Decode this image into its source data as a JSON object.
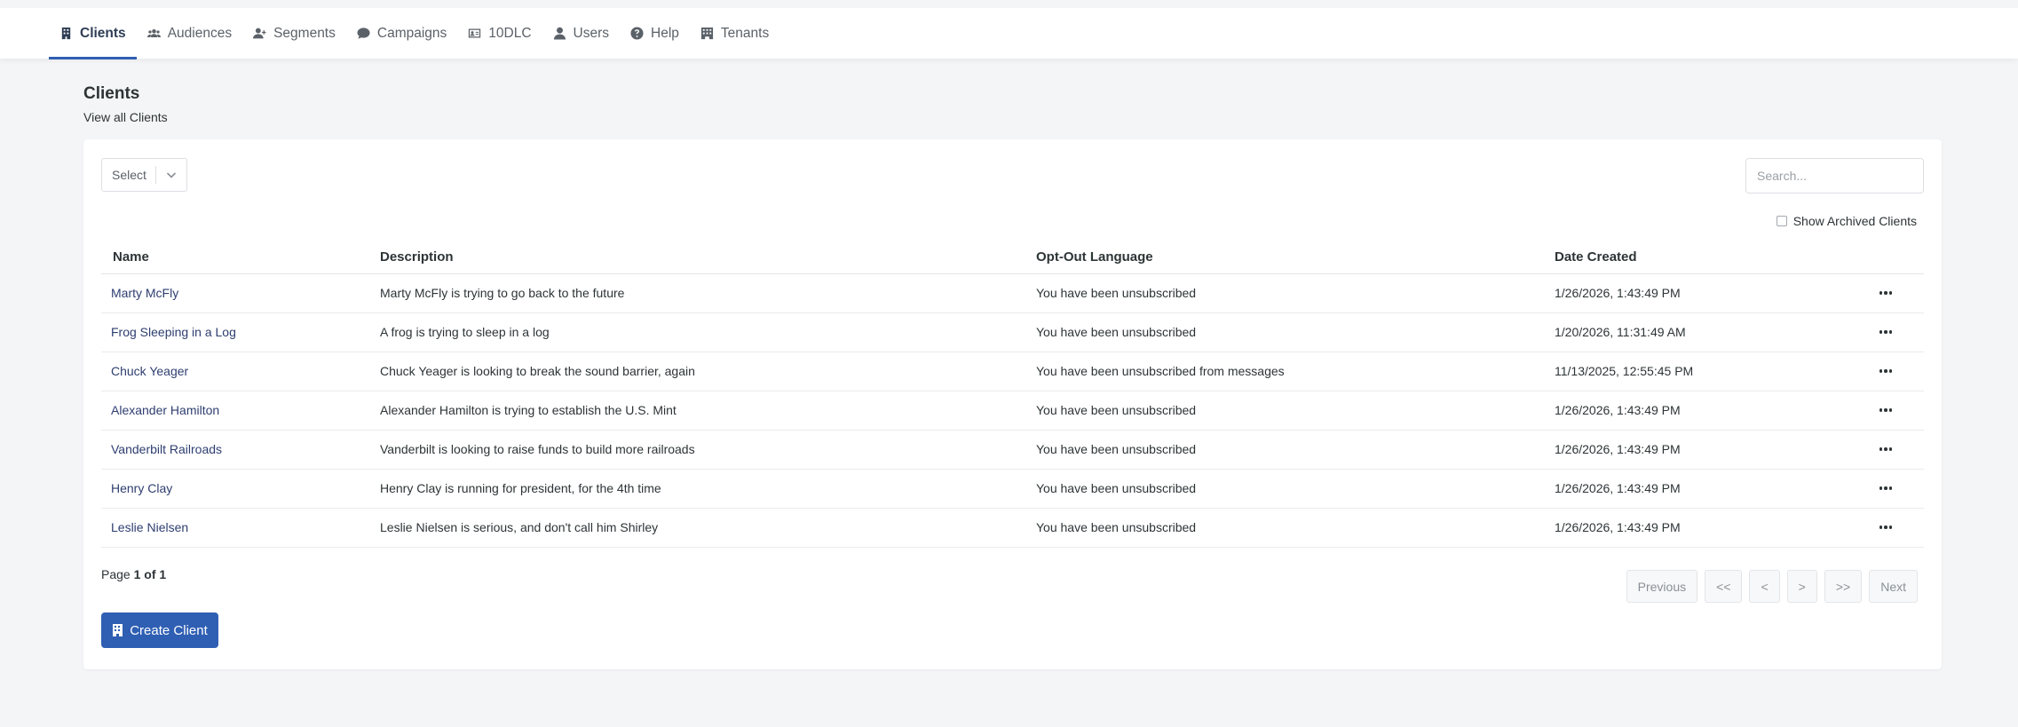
{
  "nav": {
    "items": [
      {
        "label": "Clients",
        "icon": "building-icon",
        "active": true
      },
      {
        "label": "Audiences",
        "icon": "users-icon"
      },
      {
        "label": "Segments",
        "icon": "user-plus-icon"
      },
      {
        "label": "Campaigns",
        "icon": "comment-icon"
      },
      {
        "label": "10DLC",
        "icon": "id-card-icon"
      },
      {
        "label": "Users",
        "icon": "user-icon"
      },
      {
        "label": "Help",
        "icon": "question-circle-icon"
      },
      {
        "label": "Tenants",
        "icon": "building-columns-icon"
      }
    ]
  },
  "page": {
    "title": "Clients",
    "subtitle": "View all Clients"
  },
  "filters": {
    "select_label": "Select",
    "search_placeholder": "Search...",
    "show_archived_label": "Show Archived Clients",
    "show_archived_checked": false
  },
  "table": {
    "headers": {
      "name": "Name",
      "description": "Description",
      "opt_out": "Opt-Out Language",
      "date_created": "Date Created"
    },
    "rows": [
      {
        "name": "Marty McFly",
        "description": "Marty McFly is trying to go back to the future",
        "opt_out": "You have been unsubscribed",
        "date": "1/26/2026, 1:43:49 PM"
      },
      {
        "name": "Frog Sleeping in a Log",
        "description": "A frog is trying to sleep in a log",
        "opt_out": "You have been unsubscribed",
        "date": "1/20/2026, 11:31:49 AM"
      },
      {
        "name": "Chuck Yeager",
        "description": "Chuck Yeager is looking to break the sound barrier, again",
        "opt_out": "You have been unsubscribed from messages",
        "date": "11/13/2025, 12:55:45 PM"
      },
      {
        "name": "Alexander Hamilton",
        "description": "Alexander Hamilton is trying to establish the U.S. Mint",
        "opt_out": "You have been unsubscribed",
        "date": "1/26/2026, 1:43:49 PM"
      },
      {
        "name": "Vanderbilt Railroads",
        "description": "Vanderbilt is looking to raise funds to build more railroads",
        "opt_out": "You have been unsubscribed",
        "date": "1/26/2026, 1:43:49 PM"
      },
      {
        "name": "Henry Clay",
        "description": "Henry Clay is running for president, for the 4th time",
        "opt_out": "You have been unsubscribed",
        "date": "1/26/2026, 1:43:49 PM"
      },
      {
        "name": "Leslie Nielsen",
        "description": "Leslie Nielsen is serious, and don't call him Shirley",
        "opt_out": "You have been unsubscribed",
        "date": "1/26/2026, 1:43:49 PM"
      }
    ]
  },
  "pagination": {
    "page_prefix": "Page ",
    "page_value": "1 of 1",
    "previous": "Previous",
    "first": "<<",
    "prev": "<",
    "next_single": ">",
    "last": ">>",
    "next": "Next"
  },
  "actions": {
    "create_client": "Create Client"
  },
  "colors": {
    "accent": "#2f5fb3",
    "link": "#2e3e70"
  }
}
